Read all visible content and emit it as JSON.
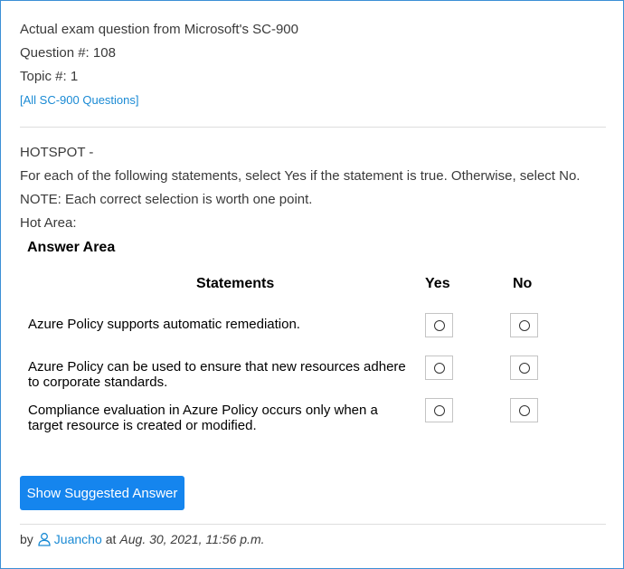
{
  "header": {
    "exam_line": "Actual exam question from Microsoft's SC-900",
    "question_number": "Question #: 108",
    "topic_number": "Topic #: 1",
    "all_questions_link": "[All SC-900 Questions]"
  },
  "question": {
    "type_label": "HOTSPOT -",
    "instruction": "For each of the following statements, select Yes if the statement is true. Otherwise, select No.",
    "note": "NOTE: Each correct selection is worth one point.",
    "hot_area_label": "Hot Area:"
  },
  "answer_area": {
    "title": "Answer Area",
    "headers": {
      "statements": "Statements",
      "yes": "Yes",
      "no": "No"
    },
    "rows": [
      {
        "statement_line1": "Azure Policy supports automatic remediation.",
        "statement_line2": ""
      },
      {
        "statement_line1": "Azure Policy can be used to ensure that new resources adhere",
        "statement_line2": "to corporate standards."
      },
      {
        "statement_line1": "Compliance evaluation in Azure Policy occurs only when a",
        "statement_line2": "target resource is created or modified."
      }
    ]
  },
  "actions": {
    "show_answer_label": "Show Suggested Answer"
  },
  "footer": {
    "by_label": "by",
    "username": "Juancho",
    "at_label": "at",
    "timestamp": "Aug. 30, 2021, 11:56 p.m."
  },
  "colors": {
    "accent": "#1585ee",
    "link": "#1a8ad4",
    "border": "#3b8fd6"
  },
  "icons": {
    "user": "user-outline-icon",
    "radio": "radio-circle-icon"
  }
}
